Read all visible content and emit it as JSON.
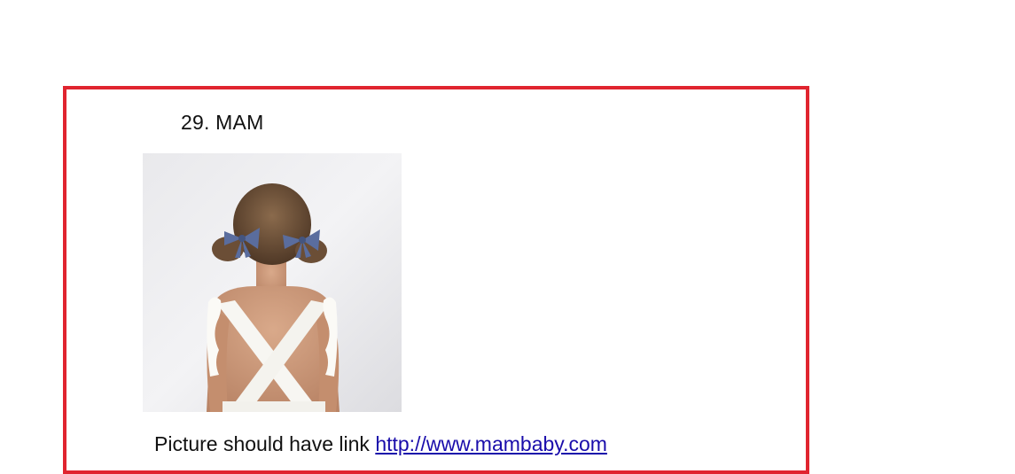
{
  "item": {
    "heading": "29. MAM",
    "caption_text": "Picture should have link ",
    "link_text": "http://www.mambaby.com"
  },
  "colors": {
    "frame_border": "#e0242f",
    "link": "#1a0dab"
  },
  "photo": {
    "description_icon": "child-back-photo"
  }
}
